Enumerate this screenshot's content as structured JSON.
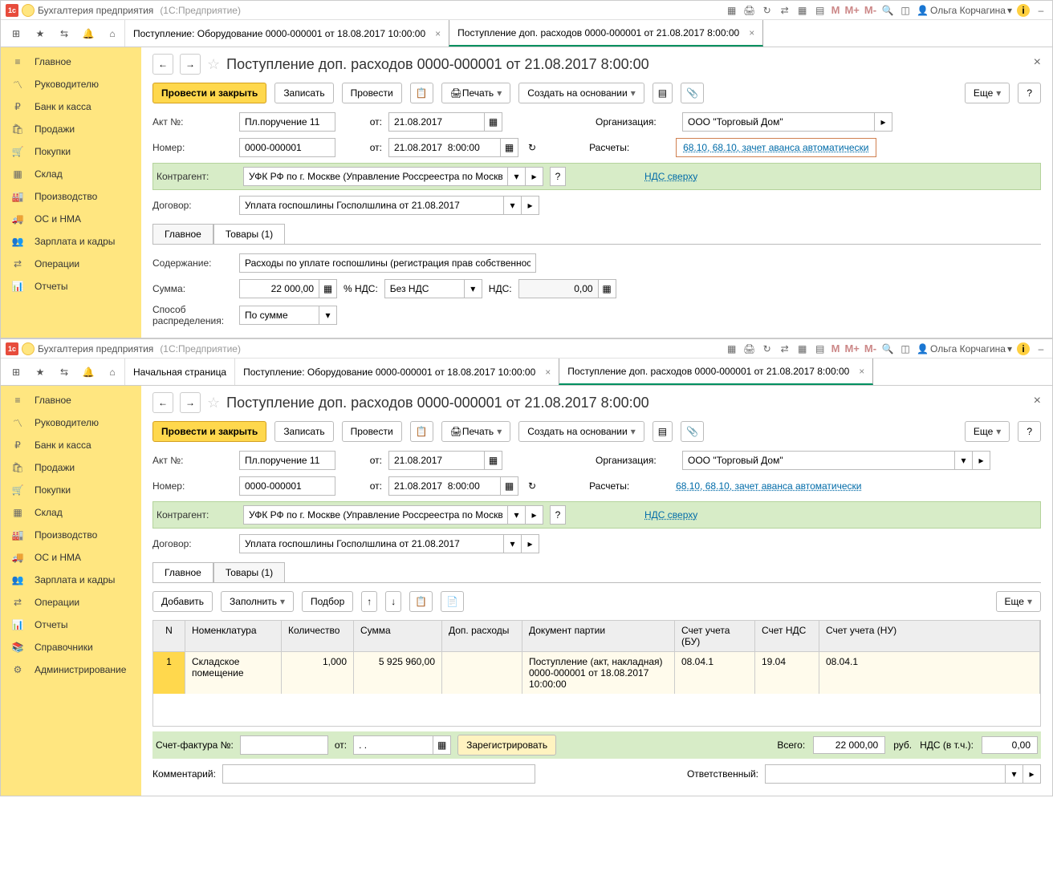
{
  "titlebar": {
    "app": "Бухгалтерия предприятия",
    "sub": "(1С:Предприятие)",
    "m": "M",
    "mp": "M+",
    "mm": "M-",
    "user_icon": "👤",
    "user": "Ольга Корчагина",
    "info": "i"
  },
  "navicons": {
    "grid": "⊞",
    "star": "★",
    "link": "⇆",
    "bell": "🔔",
    "home": "⌂"
  },
  "tabs_top": [
    {
      "label": "Поступление: Оборудование 0000-000001 от 18.08.2017 10:00:00",
      "active": false
    },
    {
      "label": "Поступление доп. расходов 0000-000001 от 21.08.2017 8:00:00",
      "active": true
    }
  ],
  "tabs_bot": [
    {
      "label": "Начальная страница"
    },
    {
      "label": "Поступление: Оборудование 0000-000001 от 18.08.2017 10:00:00"
    },
    {
      "label": "Поступление доп. расходов 0000-000001 от 21.08.2017 8:00:00",
      "active": true
    }
  ],
  "sidebar": {
    "glavnoe": "Главное",
    "ruk": "Руководителю",
    "bank": "Банк и касса",
    "prod": "Продажи",
    "pok": "Покупки",
    "sklad": "Склад",
    "proizv": "Производство",
    "os": "ОС и НМА",
    "zp": "Зарплата и кадры",
    "oper": "Операции",
    "otch": "Отчеты",
    "sprav": "Справочники",
    "admin": "Администрирование"
  },
  "page_title": "Поступление доп. расходов 0000-000001 от 21.08.2017 8:00:00",
  "toolbar": {
    "primary": "Провести и закрыть",
    "save": "Записать",
    "post": "Провести",
    "print": "Печать",
    "create": "Создать на основании",
    "more": "Еще",
    "help": "?"
  },
  "form": {
    "akt_lbl": "Акт №:",
    "akt": "Пл.поручение 11",
    "ot": "от:",
    "akt_date": "21.08.2017",
    "nomer_lbl": "Номер:",
    "nomer": "0000-000001",
    "nomer_date": "21.08.2017  8:00:00",
    "org_lbl": "Организация:",
    "org": "ООО \"Торговый Дом\"",
    "rasch_lbl": "Расчеты:",
    "rasch": "68.10, 68.10, зачет аванса автоматически",
    "kontr_lbl": "Контрагент:",
    "kontr": "УФК РФ по г. Москве (Управление Россреестра по Москв",
    "nds_link": "НДС сверху",
    "dogovor_lbl": "Договор:",
    "dogovor": "Уплата госпошлины Госполшлина от 21.08.2017",
    "tab_main": "Главное",
    "tab_goods": "Товары (1)",
    "soderzh_lbl": "Содержание:",
    "soderzh": "Расходы по уплате госпошлины (регистрация прав собственнос",
    "summa_lbl": "Сумма:",
    "summa": "22 000,00",
    "pct": "% НДС:",
    "pct_val": "Без НДС",
    "nds_lbl": "НДС:",
    "nds_val": "0,00",
    "sposob_lbl": "Способ\nраспределения:",
    "sposob": "По сумме"
  },
  "goods": {
    "add": "Добавить",
    "fill": "Заполнить",
    "select": "Подбор",
    "more": "Еще",
    "cols": {
      "n": "N",
      "nom": "Номенклатура",
      "qty": "Количество",
      "sum": "Сумма",
      "dop": "Доп. расходы",
      "doc": "Документ партии",
      "acc_bu": "Счет учета (БУ)",
      "acc_nds": "Счет НДС",
      "acc_nu": "Счет учета (НУ)"
    },
    "row": {
      "n": "1",
      "nom": "Складское помещение",
      "qty": "1,000",
      "sum": "5 925 960,00",
      "dop": "",
      "doc": "Поступление (акт, накладная) 0000-000001 от 18.08.2017 10:00:00",
      "acc_bu": "08.04.1",
      "acc_nds": "19.04",
      "acc_nu": "08.04.1"
    }
  },
  "footer": {
    "sf_lbl": "Счет-фактура №:",
    "ot": "от:",
    "sf_date": ". .",
    "reg": "Зарегистрировать",
    "total_lbl": "Всего:",
    "total": "22 000,00",
    "rub": "руб.",
    "nds_lbl": "НДС (в т.ч.):",
    "nds": "0,00",
    "comment_lbl": "Комментарий:",
    "resp_lbl": "Ответственный:"
  }
}
